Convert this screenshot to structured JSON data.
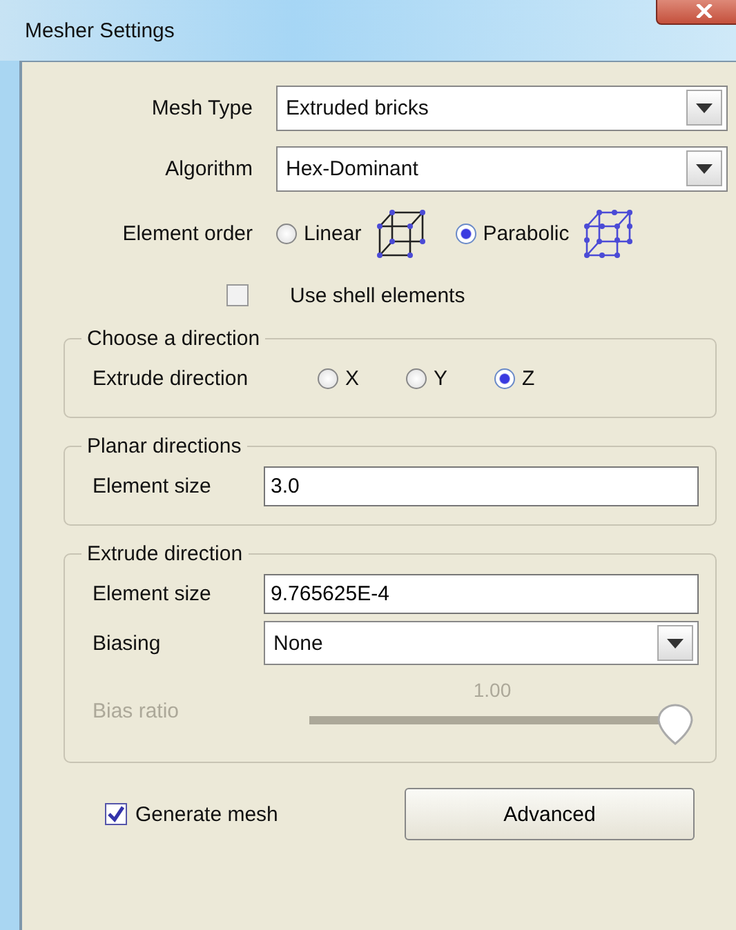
{
  "window": {
    "title": "Mesher Settings"
  },
  "fields": [
    {
      "kind": "dropdown",
      "label": "Mesh Type",
      "value": "Extruded bricks"
    },
    {
      "kind": "dropdown",
      "label": "Algorithm",
      "value": "Hex-Dominant"
    }
  ],
  "element_order": {
    "label": "Element order",
    "options": [
      {
        "label": "Linear",
        "selected": false
      },
      {
        "label": "Parabolic",
        "selected": true
      }
    ]
  },
  "shell": {
    "label": "Use shell elements",
    "checked": false
  },
  "groups": [
    {
      "title": "Choose a direction",
      "rows": [
        {
          "kind": "radio",
          "label": "Extrude direction",
          "options": [
            {
              "label": "X",
              "selected": false
            },
            {
              "label": "Y",
              "selected": false
            },
            {
              "label": "Z",
              "selected": true
            }
          ]
        }
      ]
    },
    {
      "title": "Planar directions",
      "rows": [
        {
          "kind": "text",
          "label": "Element size",
          "value": "3.0"
        }
      ]
    },
    {
      "title": "Extrude direction",
      "rows": [
        {
          "kind": "text",
          "label": "Element size",
          "value": "9.765625E-4"
        },
        {
          "kind": "dropdown",
          "label": "Biasing",
          "value": "None"
        },
        {
          "kind": "slider",
          "label": "Bias ratio",
          "reading": "1.00",
          "level": 1,
          "disabled": true
        }
      ]
    }
  ],
  "generate": {
    "label": "Generate mesh",
    "checked": true
  },
  "buttons": [
    "Advanced"
  ]
}
